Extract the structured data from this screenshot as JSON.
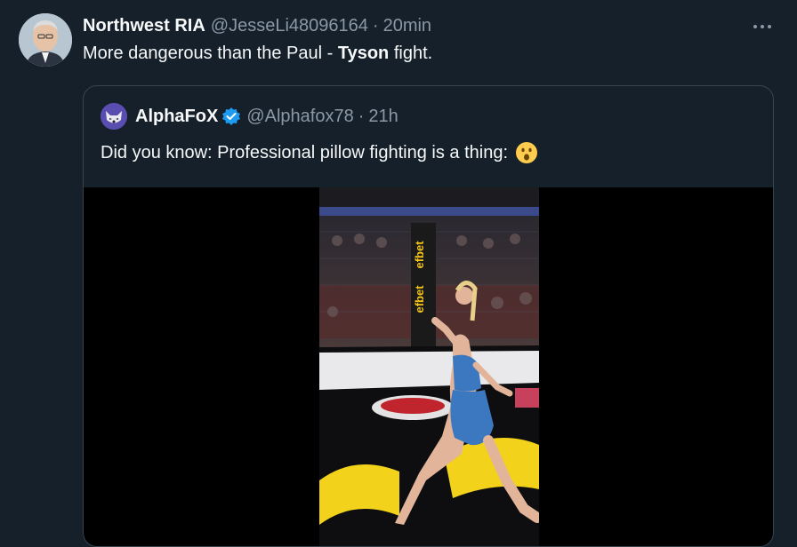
{
  "tweet": {
    "author_name": "Northwest RIA",
    "handle": "@JesseLi48096164",
    "separator": "·",
    "time": "20min",
    "text_before": "More dangerous than the Paul - ",
    "text_bold": "Tyson",
    "text_after": " fight.",
    "more_icon": "more-horizontal-icon"
  },
  "quote": {
    "author_name": "AlphaFoX",
    "handle": "@Alphafox78",
    "separator": "·",
    "time": "21h",
    "text": "Did you know: Professional pillow fighting is a thing:",
    "emoji": "surprised-face-icon",
    "verified_icon": "verified-badge-icon",
    "media": {
      "type": "video",
      "signs": [
        "efbet",
        "efbet"
      ]
    }
  },
  "colors": {
    "background": "#15202b",
    "text": "#f7f9f9",
    "muted": "#8b98a5",
    "border": "#38444d",
    "verified": "#1d9bf0"
  }
}
